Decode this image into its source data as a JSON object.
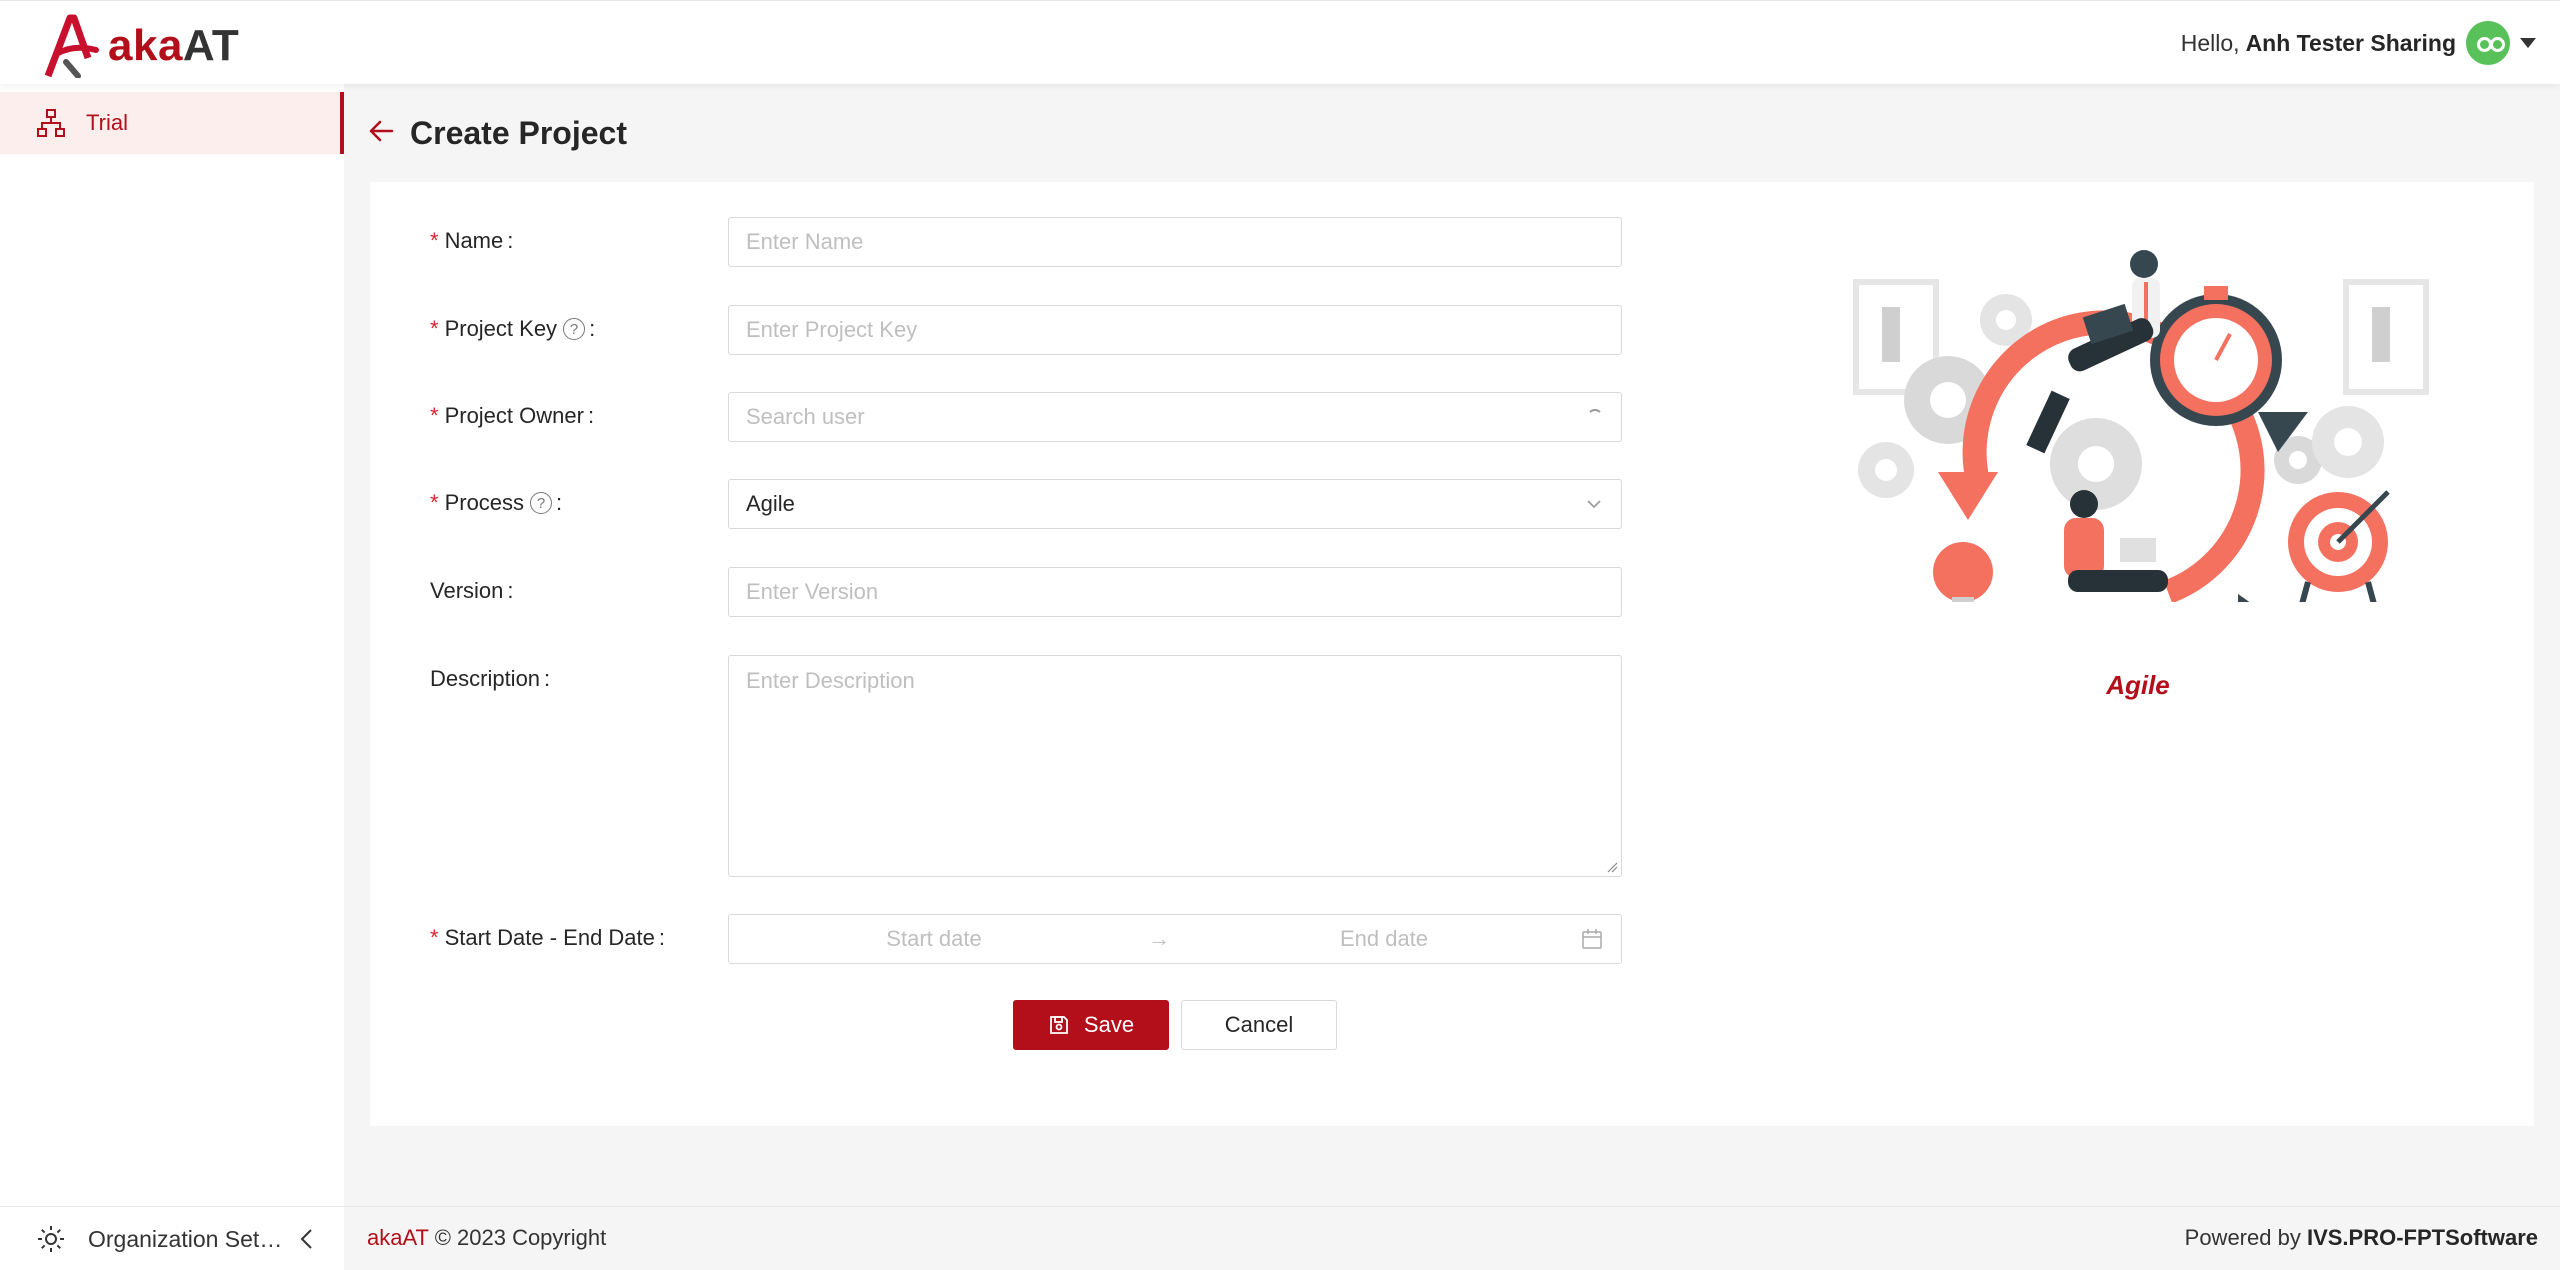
{
  "header": {
    "logo_text_aka": "aka",
    "logo_text_at": "AT",
    "greeting": "Hello,",
    "user_name": "Anh Tester Sharing"
  },
  "sidebar": {
    "items": [
      {
        "label": "Trial",
        "icon": "sitemap-icon"
      }
    ]
  },
  "page": {
    "title": "Create Project",
    "back_icon": "arrow-left-icon"
  },
  "form": {
    "name": {
      "label": "Name",
      "placeholder": "Enter Name",
      "required": true
    },
    "project_key": {
      "label": "Project Key",
      "placeholder": "Enter Project Key",
      "required": true,
      "help": "?"
    },
    "project_owner": {
      "label": "Project Owner",
      "placeholder": "Search user",
      "required": true
    },
    "process": {
      "label": "Process",
      "value": "Agile",
      "required": true,
      "help": "?"
    },
    "version": {
      "label": "Version",
      "placeholder": "Enter Version",
      "required": false
    },
    "description": {
      "label": "Description",
      "placeholder": "Enter Description",
      "required": false
    },
    "date_range": {
      "label": "Start Date - End Date",
      "start_placeholder": "Start date",
      "end_placeholder": "End date",
      "separator": "→",
      "required": true
    },
    "required_mark": "*",
    "colon": ":"
  },
  "actions": {
    "save_label": "Save",
    "cancel_label": "Cancel"
  },
  "illustration": {
    "caption": "Agile"
  },
  "footer": {
    "org_settings_label": "Organization Setti...",
    "brand": "akaAT",
    "copyright": "© 2023 Copyright",
    "powered_by": "Powered by",
    "company": "IVS.PRO-FPTSoftware"
  },
  "colors": {
    "accent": "#b30f1a",
    "accent_light": "#fdeeee",
    "illustration_coral": "#f4705f",
    "illustration_dark": "#37474f"
  }
}
